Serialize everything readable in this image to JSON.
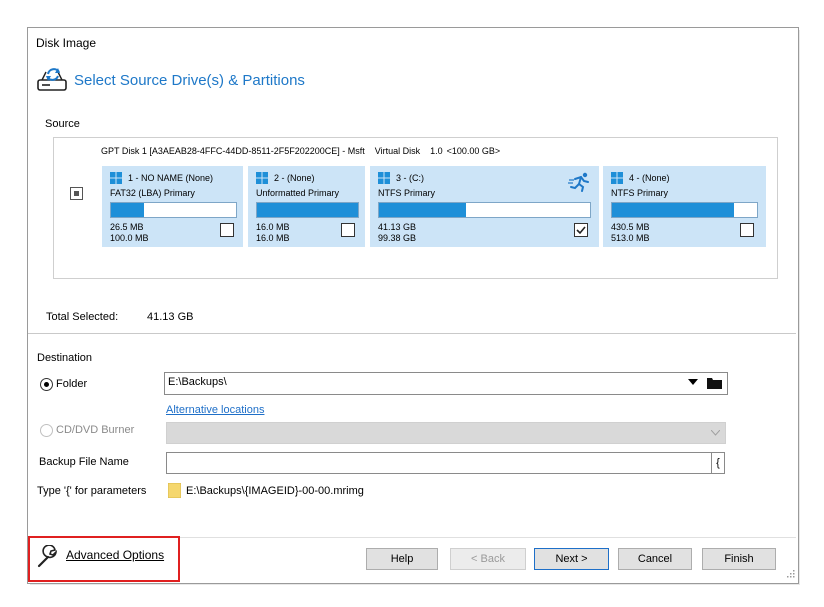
{
  "window": {
    "title": "Disk Image"
  },
  "header": {
    "title": "Select Source Drive(s) & Partitions",
    "icon": "disk-image-icon",
    "accent": "#1e78c8"
  },
  "source": {
    "label": "Source",
    "disk": {
      "name": "GPT Disk 1 [A3AEAB28-4FFC-44DD-8511-2F5F202200CE] - Msft",
      "type": "Virtual Disk",
      "version": "1.0",
      "size": "<100.00 GB>",
      "partial_checked": true
    },
    "partitions": [
      {
        "name": "1 - NO NAME (None)",
        "type": "FAT32 (LBA) Primary",
        "used": "26.5 MB",
        "total": "100.0 MB",
        "fill": 0.26,
        "checked": false,
        "icon": "windows-icon"
      },
      {
        "name": "2 - (None)",
        "type": "Unformatted Primary",
        "used": "16.0 MB",
        "total": "16.0 MB",
        "fill": 1.0,
        "checked": false,
        "icon": "windows-icon"
      },
      {
        "name": "3 - (C:)",
        "type": "NTFS Primary",
        "used": "41.13 GB",
        "total": "99.38 GB",
        "fill": 0.41,
        "checked": true,
        "icon": "windows-icon",
        "active_icon": "running-man-icon"
      },
      {
        "name": "4 - (None)",
        "type": "NTFS Primary",
        "used": "430.5 MB",
        "total": "513.0 MB",
        "fill": 0.84,
        "checked": false,
        "icon": "windows-icon"
      }
    ]
  },
  "total": {
    "label": "Total Selected:",
    "value": "41.13 GB"
  },
  "destination": {
    "label": "Destination",
    "folder": {
      "label": "Folder",
      "selected": true,
      "value": "E:\\Backups\\"
    },
    "alt_link": "Alternative locations",
    "cd": {
      "label": "CD/DVD Burner",
      "selected": false,
      "enabled": false
    },
    "file_name": {
      "label": "Backup File Name",
      "value": "",
      "brace": "{"
    },
    "params": {
      "hint": "Type '{' for parameters",
      "path": "E:\\Backups\\{IMAGEID}-00-00.mrimg"
    }
  },
  "footer": {
    "advanced": "Advanced Options",
    "buttons": {
      "help": "Help",
      "back": "< Back",
      "next": "Next >",
      "cancel": "Cancel",
      "finish": "Finish"
    }
  }
}
